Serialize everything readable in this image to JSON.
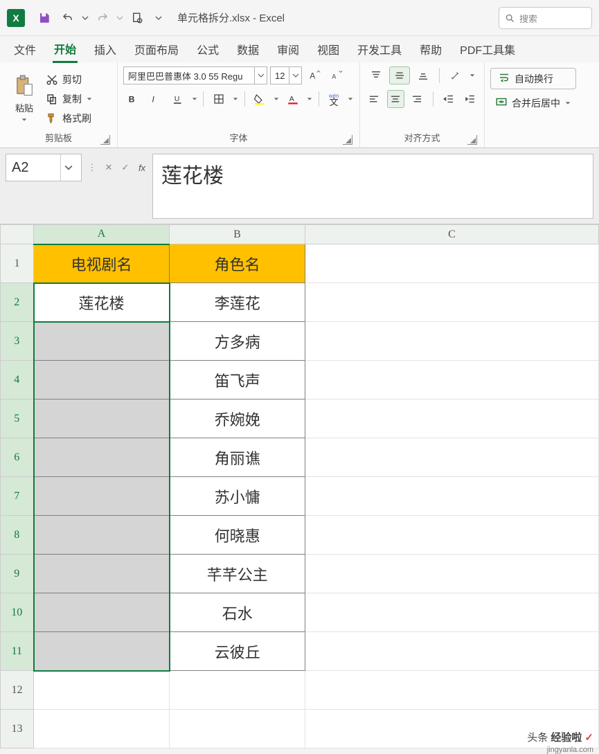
{
  "window": {
    "title": "单元格拆分.xlsx  -  Excel",
    "search_placeholder": "搜索"
  },
  "tabs": {
    "file": "文件",
    "home": "开始",
    "insert": "插入",
    "layout": "页面布局",
    "formulas": "公式",
    "data": "数据",
    "review": "审阅",
    "view": "视图",
    "developer": "开发工具",
    "help": "帮助",
    "pdf": "PDF工具集"
  },
  "ribbon": {
    "clipboard": {
      "paste": "粘贴",
      "cut": "剪切",
      "copy": "复制",
      "format_painter": "格式刷",
      "group_label": "剪贴板"
    },
    "font": {
      "name": "阿里巴巴普惠体 3.0 55 Regu",
      "size": "12",
      "group_label": "字体",
      "pinyin": "wén"
    },
    "alignment": {
      "group_label": "对齐方式"
    },
    "merge": {
      "wrap": "自动换行",
      "merge_center": "合并后居中"
    }
  },
  "formula_bar": {
    "name_box": "A2",
    "formula": "莲花楼"
  },
  "columns": [
    "A",
    "B",
    "C"
  ],
  "rows": [
    "1",
    "2",
    "3",
    "4",
    "5",
    "6",
    "7",
    "8",
    "9",
    "10",
    "11",
    "12",
    "13"
  ],
  "headers": {
    "A": "电视剧名",
    "B": "角色名"
  },
  "data_B": [
    "李莲花",
    "方多病",
    "笛飞声",
    "乔婉娩",
    "角丽谯",
    "苏小慵",
    "何晓惠",
    "芊芊公主",
    "石水",
    "云彼丘"
  ],
  "cell_A2": "莲花楼",
  "watermark": {
    "prefix": "头条",
    "main": "经验啦",
    "sub": "jingyanla.com",
    "check": "✓"
  }
}
